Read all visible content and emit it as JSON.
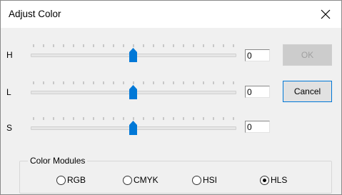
{
  "window": {
    "title": "Adjust Color"
  },
  "sliders": [
    {
      "label": "H",
      "value": "0",
      "position_fraction": 0.5
    },
    {
      "label": "L",
      "value": "0",
      "position_fraction": 0.5
    },
    {
      "label": "S",
      "value": "0",
      "position_fraction": 0.5
    }
  ],
  "buttons": {
    "ok": "OK",
    "cancel": "Cancel"
  },
  "color_modules": {
    "legend": "Color Modules",
    "options": [
      "RGB",
      "CMYK",
      "HSI",
      "HLS"
    ],
    "selected": "HLS"
  },
  "colors": {
    "accent": "#0078d7",
    "dialog_bg": "#f0f0f0"
  }
}
